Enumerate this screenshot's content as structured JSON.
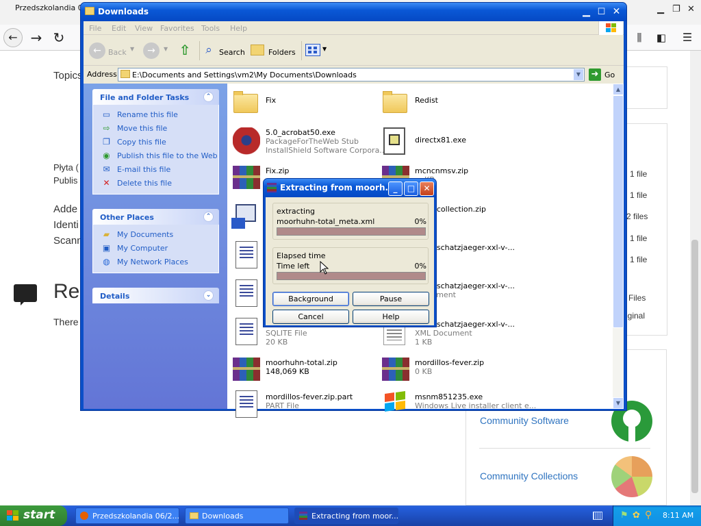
{
  "browser": {
    "tab_title": "Przedszkolandia 06",
    "topics_label": "Topics",
    "plyta_label": "Płyta (",
    "publis_label": "Publis",
    "added_label": "Adde",
    "identi_label": "Identi",
    "scann_label": "Scann",
    "re_heading": "Re",
    "there_text": "There",
    "right_rows": [
      "1 file",
      "1 file",
      "2 files",
      "1 file",
      "1 file",
      "Files",
      "iginal"
    ],
    "community_software": "Community Software",
    "community_collections": "Community Collections"
  },
  "explorer": {
    "title": "Downloads",
    "menu": [
      "File",
      "Edit",
      "View",
      "Favorites",
      "Tools",
      "Help"
    ],
    "toolbar": {
      "back": "Back",
      "search": "Search",
      "folders": "Folders"
    },
    "address_label": "Address",
    "address_value": "E:\\Documents and Settings\\vm2\\My Documents\\Downloads",
    "go_label": "Go",
    "file_tasks": {
      "title": "File and Folder Tasks",
      "items": [
        "Rename this file",
        "Move this file",
        "Copy this file",
        "Publish this file to the Web",
        "E-mail this file",
        "Delete this file"
      ]
    },
    "other_places": {
      "title": "Other Places",
      "items": [
        "My Documents",
        "My Computer",
        "My Network Places"
      ]
    },
    "details": {
      "title": "Details"
    },
    "files": [
      {
        "name": "Fix",
        "sub1": "",
        "sub2": "",
        "type": "folder"
      },
      {
        "name": "Redist",
        "sub1": "",
        "sub2": "",
        "type": "folder"
      },
      {
        "name": "5.0_acrobat50.exe",
        "sub1": "PackageForTheWeb Stub",
        "sub2": "InstallShield Software Corpora...",
        "type": "acrobat"
      },
      {
        "name": "directx81.exe",
        "sub1": "",
        "sub2": "",
        "type": "exe"
      },
      {
        "name": "Fix.zip",
        "sub1": "",
        "sub2": "",
        "type": "zip"
      },
      {
        "name": "mcncnmsv.zip",
        "sub1": "KB",
        "sub2": "",
        "type": "zip"
      },
      {
        "name": "",
        "sub1": "",
        "sub2": "",
        "type": "setup"
      },
      {
        "name": "huhn-collection.zip",
        "sub1": "",
        "sub2": "",
        "type": "none"
      },
      {
        "name": "",
        "sub1": "",
        "sub2": "",
        "type": "doc"
      },
      {
        "name": "huhn-schatzjaeger-xxl-v-...",
        "sub1": "KB",
        "sub2": "",
        "type": "none"
      },
      {
        "name": "",
        "sub1": "",
        "sub2": "",
        "type": "doc"
      },
      {
        "name": "huhn-schatzjaeger-xxl-v-...",
        "sub1": "Document",
        "sub2": "",
        "type": "none"
      },
      {
        "name": "",
        "sub1": "SQLITE File",
        "sub2": "20 KB",
        "type": "doc"
      },
      {
        "name": "huhn-schatzjaeger-xxl-v-...",
        "sub1": "XML Document",
        "sub2": "1 KB",
        "type": "xml"
      },
      {
        "name": "moorhuhn-total.zip",
        "sub1": "148,069 KB",
        "sub2": "",
        "type": "zip"
      },
      {
        "name": "mordillos-fever.zip",
        "sub1": "0 KB",
        "sub2": "",
        "type": "zip"
      },
      {
        "name": "mordillos-fever.zip.part",
        "sub1": "PART File",
        "sub2": "",
        "type": "doc"
      },
      {
        "name": "msnm851235.exe",
        "sub1": "Windows Live installer client e...",
        "sub2": "",
        "type": "windows"
      }
    ]
  },
  "dialog": {
    "title": "Extracting from moorh...",
    "extracting_label": "extracting",
    "current_file": "moorhuhn-total_meta.xml",
    "file_percent": "0%",
    "file_progress": 0,
    "elapsed_label": "Elapsed time",
    "time_left_label": "Time left",
    "total_percent": "0%",
    "total_progress": 0,
    "buttons": {
      "background": "Background",
      "pause": "Pause",
      "cancel": "Cancel",
      "help": "Help"
    }
  },
  "taskbar": {
    "start_label": "start",
    "tasks": [
      "Przedszkolandia 06/2...",
      "Downloads",
      "Extracting from moor..."
    ],
    "clock": "8:11 AM"
  }
}
